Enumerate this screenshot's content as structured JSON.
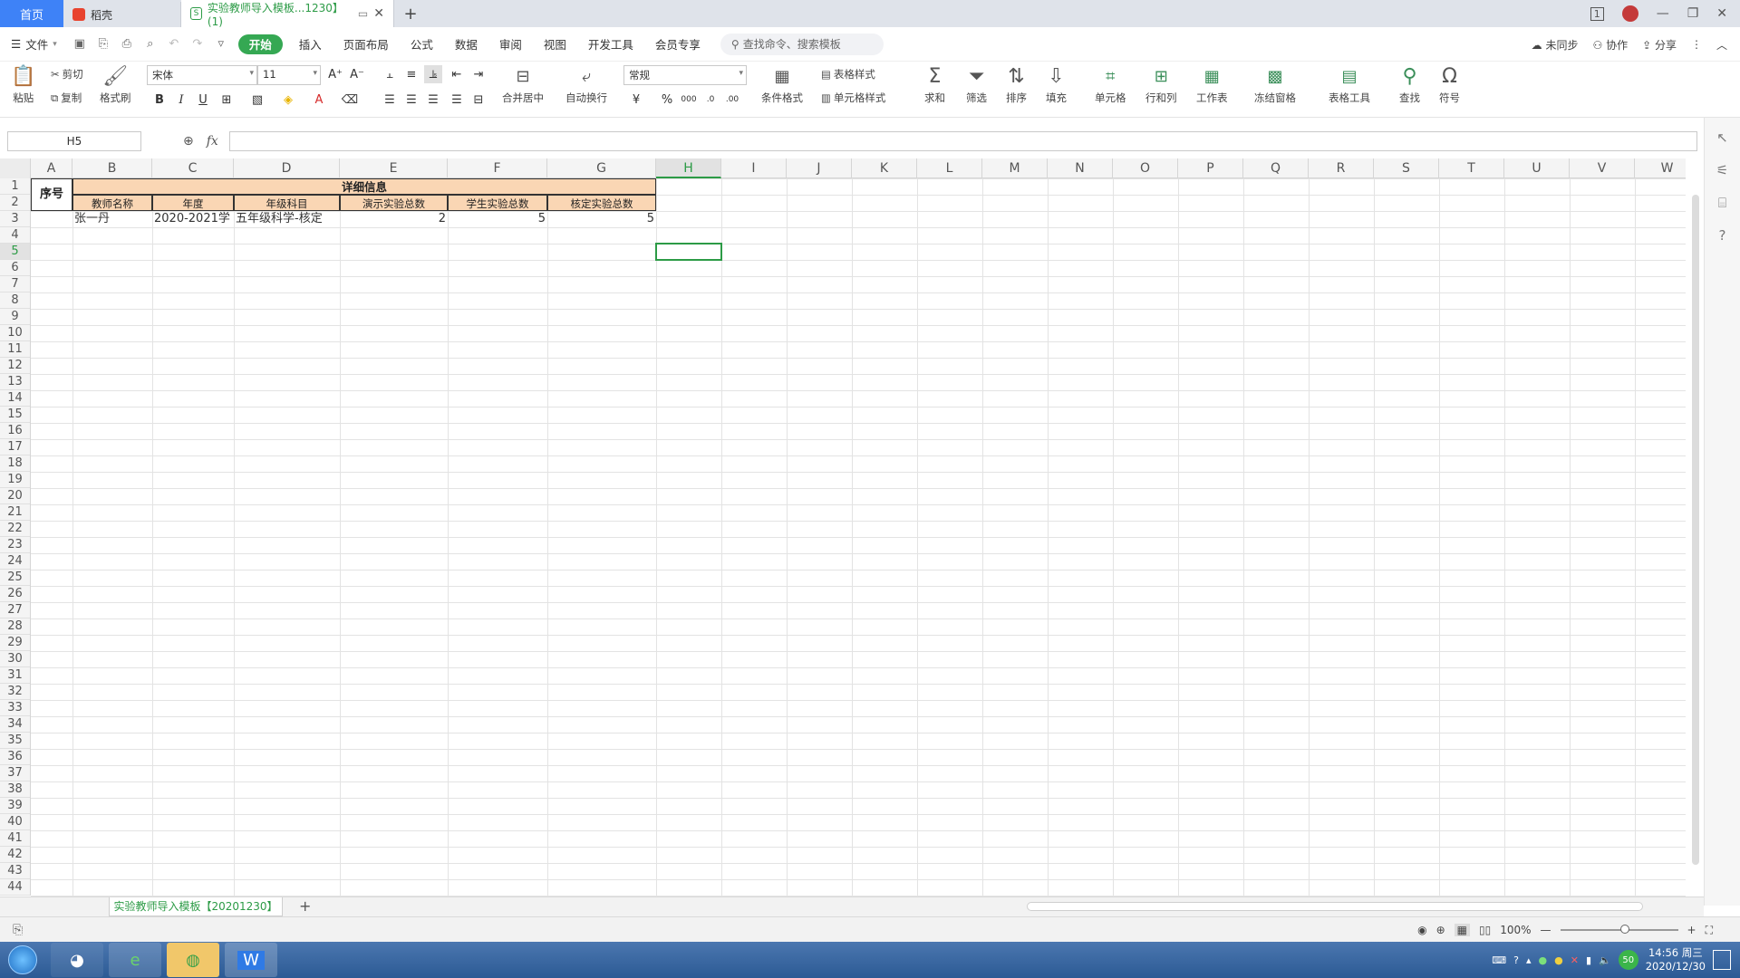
{
  "tabs": {
    "home": "首页",
    "daoke": "稻壳",
    "active": "实验教师导入模板...1230】(1)"
  },
  "menu": {
    "file": "文件",
    "items": [
      "开始",
      "插入",
      "页面布局",
      "公式",
      "数据",
      "审阅",
      "视图",
      "开发工具",
      "会员专享"
    ],
    "search_placeholder": "查找命令、搜索模板",
    "sync": "未同步",
    "collab": "协作",
    "share": "分享"
  },
  "ribbon": {
    "paste": "粘贴",
    "cut": "剪切",
    "copy": "复制",
    "format_painter": "格式刷",
    "font_name": "宋体",
    "font_size": "11",
    "merge_center": "合并居中",
    "auto_wrap": "自动换行",
    "number_format": "常规",
    "cond_format": "条件格式",
    "table_style": "表格样式",
    "cell_style": "单元格样式",
    "sum": "求和",
    "filter": "筛选",
    "sort": "排序",
    "fill": "填充",
    "cell": "单元格",
    "row_col": "行和列",
    "worksheet": "工作表",
    "freeze": "冻结窗格",
    "table_tools": "表格工具",
    "find": "查找",
    "symbol": "符号"
  },
  "formula_bar": {
    "name_box": "H5",
    "fx": "fx",
    "content": ""
  },
  "columns": [
    "A",
    "B",
    "C",
    "D",
    "E",
    "F",
    "G",
    "H",
    "I",
    "J",
    "K",
    "L",
    "M",
    "N",
    "O",
    "P",
    "Q",
    "R",
    "S",
    "T",
    "U",
    "V",
    "W"
  ],
  "rows": [
    "1",
    "2",
    "3",
    "4",
    "5",
    "6",
    "7",
    "8",
    "9",
    "10",
    "11",
    "12",
    "13",
    "14",
    "15",
    "16",
    "17",
    "18",
    "19",
    "20",
    "21",
    "22",
    "23",
    "24",
    "25",
    "26",
    "27",
    "28",
    "29",
    "30",
    "31",
    "32",
    "33",
    "34",
    "35",
    "36",
    "37",
    "38",
    "39",
    "40",
    "41",
    "42",
    "43",
    "44"
  ],
  "sheet": {
    "seq_header": "序号",
    "detail_header": "详细信息",
    "headers": [
      "教师名称",
      "年度",
      "年级科目",
      "演示实验总数",
      "学生实验总数",
      "核定实验总数"
    ],
    "row3": [
      "张一丹",
      "2020-2021学",
      "五年级科学-核定",
      "2",
      "5",
      "5"
    ]
  },
  "sheet_tab": "实验教师导入模板【20201230】",
  "status": {
    "zoom": "100%"
  },
  "taskbar": {
    "time": "14:56 周三",
    "date": "2020/12/30",
    "badge": "50"
  }
}
